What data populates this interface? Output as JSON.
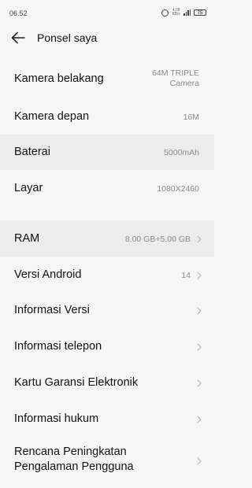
{
  "status": {
    "time": "06.52",
    "network_top": "4,08",
    "network_bottom": "KB/s",
    "battery": "75"
  },
  "header": {
    "title": "Ponsel saya"
  },
  "items": [
    {
      "label": "Kamera belakang",
      "value": "64M TRIPLE",
      "value2": "Camera"
    },
    {
      "label": "Kamera depan",
      "value": "16M"
    },
    {
      "label": "Baterai",
      "value": "5000mAh"
    },
    {
      "label": "Layar",
      "value": "1080X2460"
    },
    {
      "label": "RAM",
      "value": "8.00 GB+5.00 GB"
    },
    {
      "label": "Versi Android",
      "value": "14"
    },
    {
      "label": "Informasi Versi"
    },
    {
      "label": "Informasi telepon"
    },
    {
      "label": "Kartu Garansi Elektronik"
    },
    {
      "label": "Informasi hukum"
    },
    {
      "label": "Rencana Peningkatan",
      "label2": "Pengalaman Pengguna"
    }
  ]
}
